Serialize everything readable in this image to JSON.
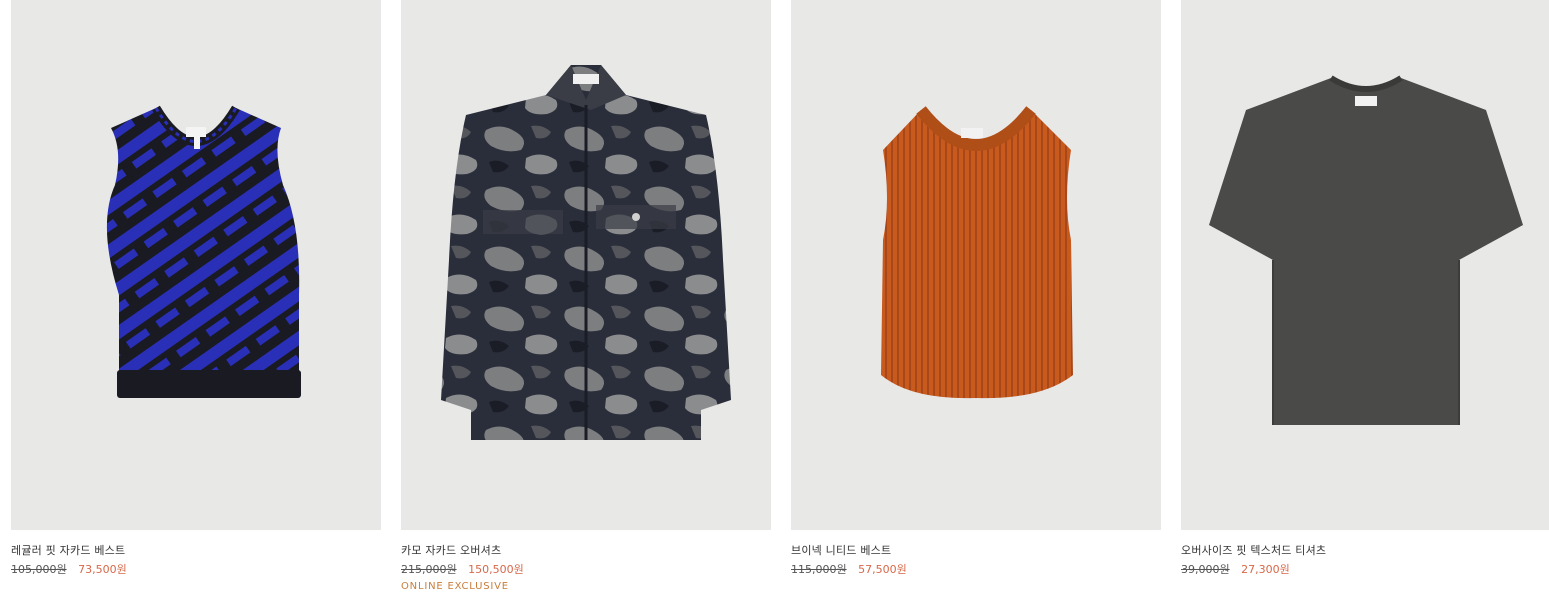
{
  "products": [
    {
      "name": "레귤러 핏 자카드 베스트",
      "original_price": "105,000원",
      "sale_price": "73,500원",
      "image_desc": "vest-blue-jacquard"
    },
    {
      "name": "카모 자카드 오버셔츠",
      "original_price": "215,000원",
      "sale_price": "150,500원",
      "badge": "ONLINE EXCLUSIVE",
      "image_desc": "overshirt-camo"
    },
    {
      "name": "브이넥 니티드 베스트",
      "original_price": "115,000원",
      "sale_price": "57,500원",
      "image_desc": "vest-orange-knit"
    },
    {
      "name": "오버사이즈 핏 텍스처드 티셔츠",
      "original_price": "39,000원",
      "sale_price": "27,300원",
      "image_desc": "tshirt-dark-grey"
    }
  ],
  "colors": {
    "image_bg": "#e8e8e7",
    "sale_price": "#d7684a",
    "badge": "#c87d3a",
    "vest_blue": "#2a2fb8",
    "vest_black": "#1a1a22",
    "vest_orange": "#c85a1e",
    "tee_grey": "#4a4a48"
  }
}
